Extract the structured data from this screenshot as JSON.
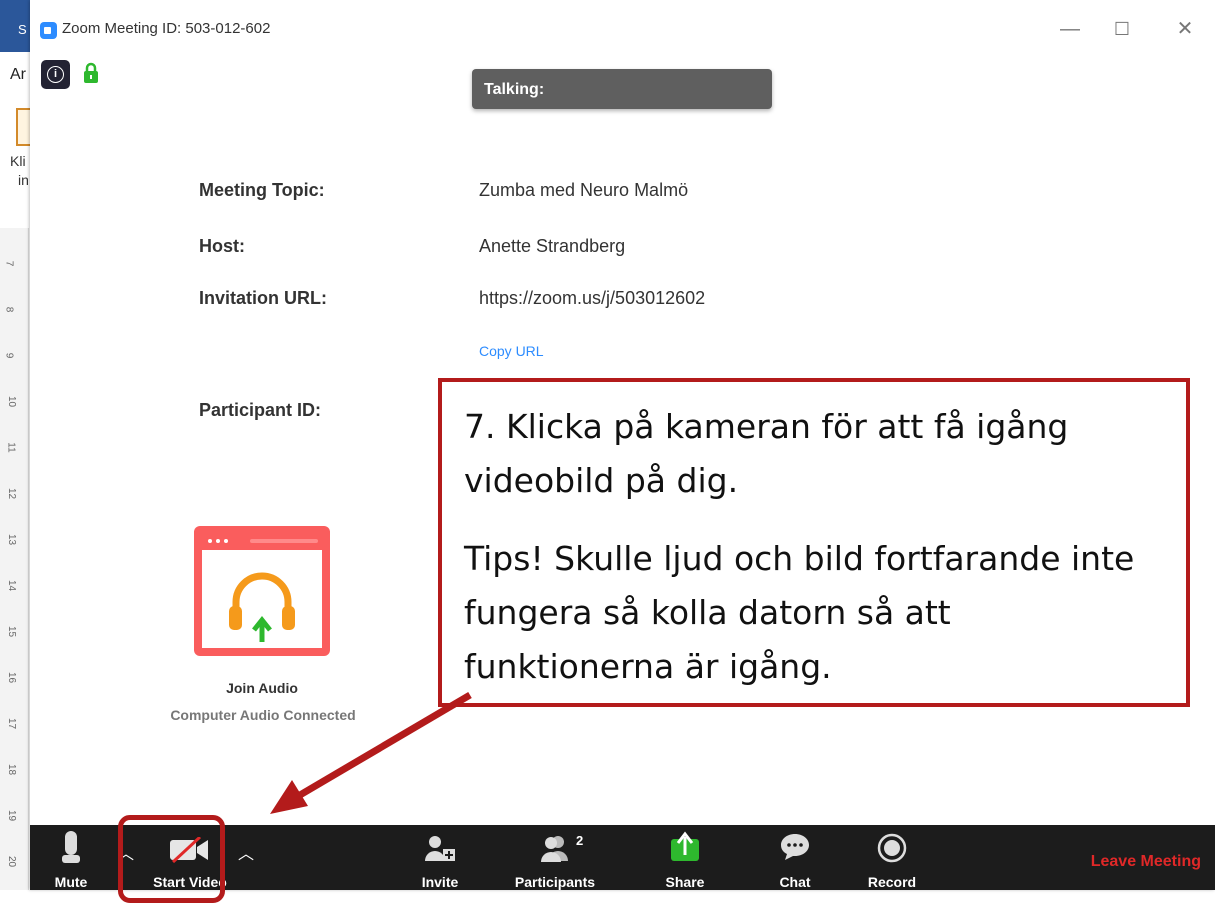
{
  "background_app": {
    "tab_letter": "S",
    "ribbon_text": "Ar",
    "paste_label_1": "Kli",
    "paste_label_2": "in",
    "ruler_numbers": [
      "7",
      "8",
      "9",
      "10",
      "11",
      "12",
      "13",
      "14",
      "15",
      "16",
      "17",
      "18",
      "19",
      "20"
    ]
  },
  "window": {
    "title": "Zoom Meeting ID: 503-012-602",
    "minimize": "—",
    "maximize": "☐",
    "close": "✕"
  },
  "talking_label": "Talking:",
  "meeting_info": {
    "topic_label": "Meeting Topic:",
    "topic_value": "Zumba med Neuro Malmö",
    "host_label": "Host:",
    "host_value": "Anette Strandberg",
    "url_label": "Invitation URL:",
    "url_value": "https://zoom.us/j/503012602",
    "copy_url": "Copy URL",
    "participant_label": "Participant ID:"
  },
  "audio": {
    "join_label": "Join Audio",
    "status": "Computer Audio Connected"
  },
  "callout": {
    "line1": "7. Klicka på kameran för att få igång",
    "line2": "videobild på dig.",
    "line3": "Tips! Skulle ljud och bild fortfarande inte",
    "line4": "fungera så kolla datorn så att",
    "line5": "funktionerna är igång."
  },
  "toolbar": {
    "mute": "Mute",
    "start_video": "Start Video",
    "invite": "Invite",
    "participants": "Participants",
    "participants_count": "2",
    "share": "Share",
    "chat": "Chat",
    "record": "Record",
    "leave": "Leave Meeting"
  },
  "colors": {
    "zoom_blue": "#2d8cff",
    "share_green": "#2eb82e",
    "leave_red": "#e02828",
    "annotation_red": "#b31b1b",
    "toolbar_bg": "#1c1c1c"
  }
}
